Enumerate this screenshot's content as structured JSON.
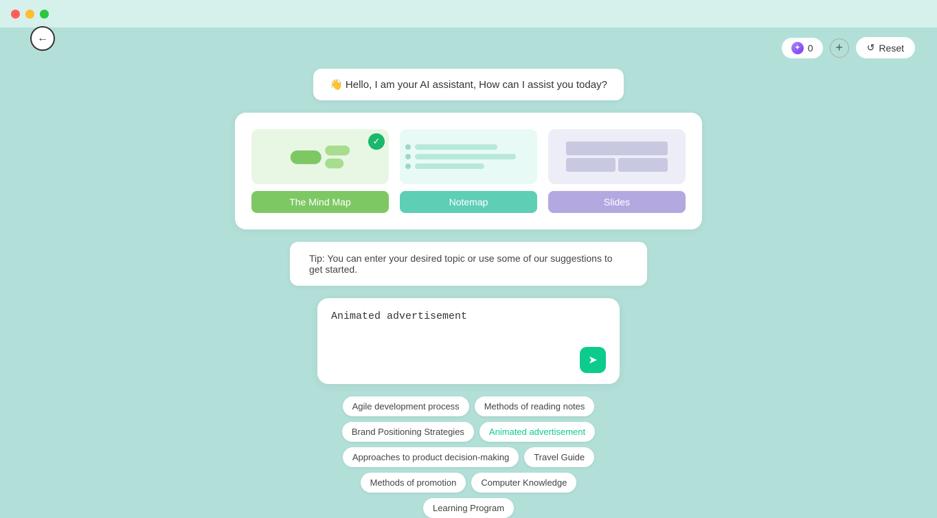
{
  "titlebar": {
    "lights": [
      "red",
      "yellow",
      "green"
    ]
  },
  "header": {
    "back_label": "←",
    "credits": "0",
    "plus_label": "+",
    "reset_label": "Reset"
  },
  "greeting": {
    "emoji": "👋",
    "text": "Hello, I am your AI assistant, How can I assist you today?"
  },
  "templates": [
    {
      "id": "mindmap",
      "label": "The Mind Map",
      "selected": true
    },
    {
      "id": "notemap",
      "label": "Notemap",
      "selected": false
    },
    {
      "id": "slides",
      "label": "Slides",
      "selected": false
    }
  ],
  "tip": {
    "text": "Tip: You can enter your desired topic or use some of our suggestions to get started."
  },
  "input": {
    "value": "Animated advertisement",
    "placeholder": "Animated advertisement"
  },
  "suggestions": [
    {
      "label": "Agile development process",
      "active": false
    },
    {
      "label": "Methods of reading notes",
      "active": false
    },
    {
      "label": "Brand Positioning Strategies",
      "active": false
    },
    {
      "label": "Animated advertisement",
      "active": true
    },
    {
      "label": "Approaches to product decision-making",
      "active": false
    },
    {
      "label": "Travel Guide",
      "active": false
    },
    {
      "label": "Methods of promotion",
      "active": false
    },
    {
      "label": "Computer Knowledge",
      "active": false
    },
    {
      "label": "Learning Program",
      "active": false
    }
  ],
  "icons": {
    "send": "➤",
    "reset_icon": "↺",
    "check": "✓"
  }
}
